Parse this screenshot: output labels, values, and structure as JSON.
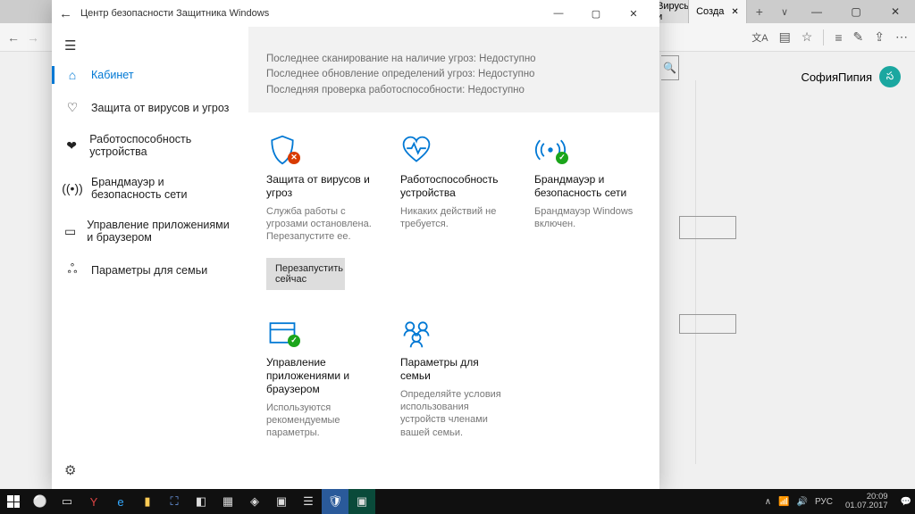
{
  "edge": {
    "tabs": [
      {
        "label": "Вирусы и"
      },
      {
        "label": "Созда"
      }
    ],
    "user_name": "СофияПипия"
  },
  "defender": {
    "title": "Центр безопасности Защитника Windows",
    "sidebar": {
      "items": [
        {
          "label": "Кабинет"
        },
        {
          "label": "Защита от вирусов и угроз"
        },
        {
          "label": "Работоспособность устройства"
        },
        {
          "label": "Брандмауэр и безопасность сети"
        },
        {
          "label": "Управление приложениями и браузером"
        },
        {
          "label": "Параметры для семьи"
        }
      ]
    },
    "status": {
      "line1": "Последнее сканирование на наличие угроз: Недоступно",
      "line2": "Последнее обновление определений угроз: Недоступно",
      "line3": "Последняя проверка работоспособности: Недоступно"
    },
    "cards": [
      {
        "title": "Защита от вирусов и угроз",
        "desc": "Служба работы с угрозами остановлена. Перезапустите ее.",
        "button": "Перезапустить сейчас"
      },
      {
        "title": "Работоспособность устройства",
        "desc": "Никаких действий не требуется."
      },
      {
        "title": "Брандмауэр и безопасность сети",
        "desc": "Брандмауэр Windows включен."
      },
      {
        "title": "Управление приложениями и браузером",
        "desc": "Используются рекомендуемые параметры."
      },
      {
        "title": "Параметры для семьи",
        "desc": "Определяйте условия использования устройств членами вашей семьи."
      }
    ]
  },
  "taskbar": {
    "lang": "РУС",
    "time": "20:09",
    "date": "01.07.2017"
  }
}
